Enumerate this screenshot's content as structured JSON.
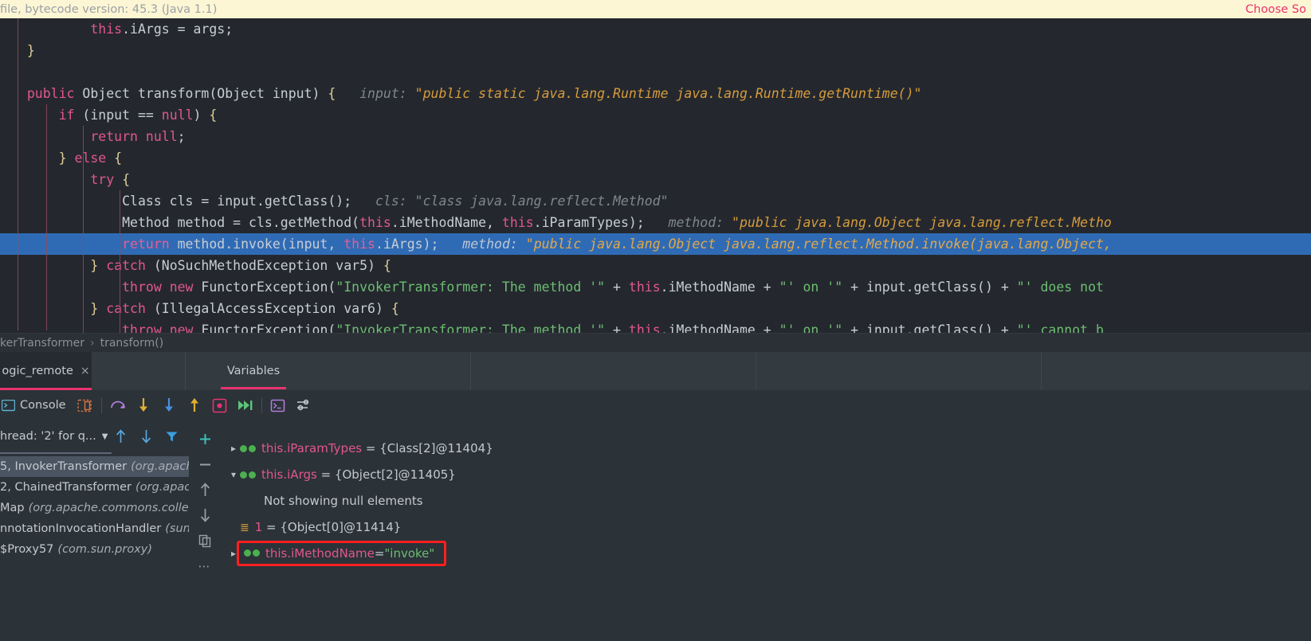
{
  "banner": {
    "message": "file, bytecode version: 45.3 (Java 1.1)",
    "action": "Choose So"
  },
  "editor": {
    "lines": [
      {
        "id": "line-this-iargs",
        "tokens": [
          {
            "t": "          ",
            "c": "pln"
          },
          {
            "t": "this",
            "c": "kw"
          },
          {
            "t": ".iArgs = args;",
            "c": "pln"
          }
        ]
      },
      {
        "id": "line-close-brace",
        "tokens": [
          {
            "t": "  ",
            "c": "pln"
          },
          {
            "t": "}",
            "c": "brc"
          }
        ]
      },
      {
        "id": "line-blank",
        "tokens": []
      },
      {
        "id": "line-transform-sig",
        "tokens": [
          {
            "t": "  ",
            "c": "pln"
          },
          {
            "t": "public",
            "c": "kw"
          },
          {
            "t": " Object transform(Object input) ",
            "c": "pln"
          },
          {
            "t": "{",
            "c": "brc"
          },
          {
            "t": "   ",
            "c": "pln"
          },
          {
            "t": "input:",
            "c": "hint"
          },
          {
            "t": " ",
            "c": "pln"
          },
          {
            "t": "\"public static java.lang.Runtime java.lang.Runtime.getRuntime()\"",
            "c": "hintv"
          }
        ]
      },
      {
        "id": "line-if-null",
        "tokens": [
          {
            "t": "      ",
            "c": "pln"
          },
          {
            "t": "if",
            "c": "kw"
          },
          {
            "t": " (input == ",
            "c": "pln"
          },
          {
            "t": "null",
            "c": "kw"
          },
          {
            "t": ") ",
            "c": "pln"
          },
          {
            "t": "{",
            "c": "brc"
          }
        ]
      },
      {
        "id": "line-return-null",
        "tokens": [
          {
            "t": "          ",
            "c": "pln"
          },
          {
            "t": "return",
            "c": "kw"
          },
          {
            "t": " ",
            "c": "pln"
          },
          {
            "t": "null",
            "c": "kw"
          },
          {
            "t": ";",
            "c": "pln"
          }
        ]
      },
      {
        "id": "line-else",
        "tokens": [
          {
            "t": "      ",
            "c": "pln"
          },
          {
            "t": "}",
            "c": "brc"
          },
          {
            "t": " ",
            "c": "pln"
          },
          {
            "t": "else",
            "c": "kw"
          },
          {
            "t": " ",
            "c": "pln"
          },
          {
            "t": "{",
            "c": "brc"
          }
        ]
      },
      {
        "id": "line-try",
        "tokens": [
          {
            "t": "          ",
            "c": "pln"
          },
          {
            "t": "try",
            "c": "kw"
          },
          {
            "t": " ",
            "c": "pln"
          },
          {
            "t": "{",
            "c": "brc"
          }
        ]
      },
      {
        "id": "line-class-cls",
        "tokens": [
          {
            "t": "              Class cls = input.getClass();",
            "c": "pln"
          },
          {
            "t": "   ",
            "c": "pln"
          },
          {
            "t": "cls:",
            "c": "hint"
          },
          {
            "t": " ",
            "c": "pln"
          },
          {
            "t": "\"class java.lang.reflect.Method\"",
            "c": "hint"
          }
        ]
      },
      {
        "id": "line-method-getmethod",
        "tokens": [
          {
            "t": "              Method method = cls.getMethod(",
            "c": "pln"
          },
          {
            "t": "this",
            "c": "kw"
          },
          {
            "t": ".iMethodName, ",
            "c": "pln"
          },
          {
            "t": "this",
            "c": "kw"
          },
          {
            "t": ".iParamTypes);",
            "c": "pln"
          },
          {
            "t": "   ",
            "c": "pln"
          },
          {
            "t": "method:",
            "c": "hint"
          },
          {
            "t": " ",
            "c": "pln"
          },
          {
            "t": "\"public java.lang.Object java.lang.reflect.Metho",
            "c": "hintv"
          }
        ]
      },
      {
        "id": "line-return-invoke",
        "selected": true,
        "tokens": [
          {
            "t": "              ",
            "c": "pln"
          },
          {
            "t": "return",
            "c": "kw"
          },
          {
            "t": " method.invoke(input, ",
            "c": "pln"
          },
          {
            "t": "this",
            "c": "kw"
          },
          {
            "t": ".iArgs);",
            "c": "pln"
          },
          {
            "t": "   ",
            "c": "pln"
          },
          {
            "t": "method:",
            "c": "hint"
          },
          {
            "t": " ",
            "c": "pln"
          },
          {
            "t": "\"public java.lang.Object java.lang.reflect.Method.invoke(java.lang.Object,",
            "c": "hintv"
          }
        ]
      },
      {
        "id": "line-catch-nosuchmethod",
        "tokens": [
          {
            "t": "          ",
            "c": "pln"
          },
          {
            "t": "}",
            "c": "brc"
          },
          {
            "t": " ",
            "c": "pln"
          },
          {
            "t": "catch",
            "c": "kw"
          },
          {
            "t": " (NoSuchMethodException var5) ",
            "c": "pln"
          },
          {
            "t": "{",
            "c": "brc"
          }
        ]
      },
      {
        "id": "line-throw-does-not-exist",
        "tokens": [
          {
            "t": "              ",
            "c": "pln"
          },
          {
            "t": "throw",
            "c": "kw"
          },
          {
            "t": " ",
            "c": "pln"
          },
          {
            "t": "new",
            "c": "kw"
          },
          {
            "t": " FunctorException(",
            "c": "pln"
          },
          {
            "t": "\"InvokerTransformer: The method '\"",
            "c": "str"
          },
          {
            "t": " + ",
            "c": "pln"
          },
          {
            "t": "this",
            "c": "kw"
          },
          {
            "t": ".iMethodName + ",
            "c": "pln"
          },
          {
            "t": "\"' on '\"",
            "c": "str"
          },
          {
            "t": " + input.getClass() + ",
            "c": "pln"
          },
          {
            "t": "\"' does not",
            "c": "str"
          }
        ]
      },
      {
        "id": "line-catch-illegalaccess",
        "tokens": [
          {
            "t": "          ",
            "c": "pln"
          },
          {
            "t": "}",
            "c": "brc"
          },
          {
            "t": " ",
            "c": "pln"
          },
          {
            "t": "catch",
            "c": "kw"
          },
          {
            "t": " (IllegalAccessException var6) ",
            "c": "pln"
          },
          {
            "t": "{",
            "c": "brc"
          }
        ]
      },
      {
        "id": "line-throw-cannot-be",
        "tokens": [
          {
            "t": "              ",
            "c": "pln"
          },
          {
            "t": "throw",
            "c": "kw"
          },
          {
            "t": " ",
            "c": "pln"
          },
          {
            "t": "new",
            "c": "kw"
          },
          {
            "t": " FunctorException(",
            "c": "pln"
          },
          {
            "t": "\"InvokerTransformer: The method '\"",
            "c": "str"
          },
          {
            "t": " + ",
            "c": "pln"
          },
          {
            "t": "this",
            "c": "kw"
          },
          {
            "t": ".iMethodName + ",
            "c": "pln"
          },
          {
            "t": "\"' on '\"",
            "c": "str"
          },
          {
            "t": " + input.getClass() + ",
            "c": "pln"
          },
          {
            "t": "\"' cannot b",
            "c": "str"
          }
        ]
      }
    ]
  },
  "breadcrumb": {
    "items": [
      "kerTransformer",
      "transform()"
    ],
    "separator": "›"
  },
  "debug": {
    "session_tab": {
      "label": "ogic_remote",
      "close": "×"
    },
    "toolbar": {
      "console_label": "Console",
      "buttons": [
        "console-view-icon",
        "layout-settings-icon",
        "step-over-icon",
        "step-into-icon",
        "force-step-into-icon",
        "step-out-icon",
        "run-to-cursor-icon",
        "evaluate-expression-icon",
        "terminal-icon",
        "settings-sliders-icon"
      ]
    },
    "frames": {
      "thread_label": "hread: '2' for q...",
      "toolbar_icons": [
        "up-arrow-icon",
        "down-arrow-icon",
        "filter-icon"
      ],
      "rows": [
        {
          "name": "5, InvokerTransformer",
          "pkg": "(org.apach",
          "active": true
        },
        {
          "name": "2, ChainedTransformer",
          "pkg": "(org.apach",
          "active": false
        },
        {
          "name": "Map",
          "pkg": "(org.apache.commons.colle",
          "active": false
        },
        {
          "name": "nnotationInvocationHandler",
          "pkg": "(sun.r",
          "active": false
        },
        {
          "name": "$Proxy57",
          "pkg": "(com.sun.proxy)",
          "active": false
        }
      ]
    },
    "midstrip_buttons": [
      "add-watch-icon",
      "remove-watch-icon",
      "move-up-icon",
      "move-down-icon",
      "copy-icon",
      "more-icon"
    ],
    "variables": {
      "tab_label": "Variables",
      "rows": [
        {
          "id": "var-iparamtypes",
          "arrow": "›",
          "icon": "watch-glasses-icon",
          "name": "this.iParamTypes",
          "eq": " = ",
          "value": "{Class[2]@11404}",
          "value_kind": "plain",
          "highlight": false
        },
        {
          "id": "var-iargs",
          "arrow": "⌄",
          "icon": "watch-glasses-icon",
          "name": "this.iArgs",
          "eq": " = ",
          "value": "{Object[2]@11405}",
          "value_kind": "plain",
          "highlight": false
        },
        {
          "id": "var-note-null-elements",
          "arrow": "",
          "icon": "none",
          "name": "",
          "eq": "",
          "value": "Not showing null elements",
          "value_kind": "note",
          "highlight": false
        },
        {
          "id": "var-array-index-1",
          "arrow": "",
          "icon": "array-list-icon",
          "name": "1",
          "eq": " = ",
          "value": "{Object[0]@11414}",
          "value_kind": "index",
          "highlight": false
        },
        {
          "id": "var-imethodname",
          "arrow": "›",
          "icon": "watch-glasses-icon",
          "name": "this.iMethodName",
          "eq": " = ",
          "value": "\"invoke\"",
          "value_kind": "string",
          "highlight": true
        }
      ],
      "overflow": "⋯"
    }
  },
  "colors": {
    "accent": "#e8336e",
    "selection": "#2f6bb5",
    "highlight_box": "#ff2020",
    "banner_bg": "#fdf6d4",
    "editor_bg": "#24282e",
    "panel_bg": "#2b3238"
  }
}
